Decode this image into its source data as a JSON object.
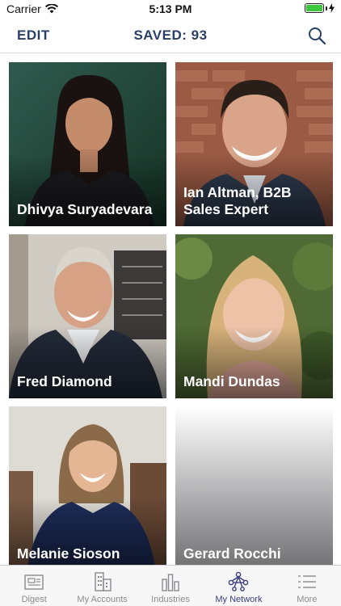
{
  "status_bar": {
    "carrier": "Carrier",
    "time": "5:13 PM",
    "battery_level": 1.0
  },
  "nav": {
    "edit_label": "EDIT",
    "title": "SAVED: 93",
    "search_icon": "search-icon"
  },
  "cards": [
    {
      "name": "Dhivya Suryadevara"
    },
    {
      "name": "Ian Altman, B2B Sales Expert"
    },
    {
      "name": "Fred Diamond"
    },
    {
      "name": "Mandi Dundas"
    },
    {
      "name": "Melanie Sioson"
    },
    {
      "name": "Gerard Rocchi"
    }
  ],
  "tabs": [
    {
      "label": "Digest",
      "icon": "digest-icon"
    },
    {
      "label": "My Accounts",
      "icon": "accounts-icon"
    },
    {
      "label": "Industries",
      "icon": "industries-icon"
    },
    {
      "label": "My Network",
      "icon": "network-icon",
      "active": true
    },
    {
      "label": "More",
      "icon": "more-icon"
    }
  ],
  "colors": {
    "accent": "#2a3f66",
    "active_tab": "#3b3f80",
    "inactive_tab": "#8a8a8e",
    "battery": "#3cc83c"
  }
}
